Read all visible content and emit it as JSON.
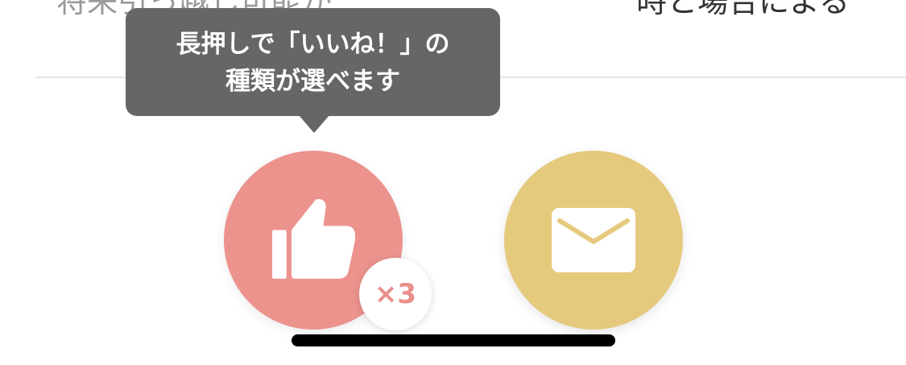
{
  "profile_row": {
    "left_value": "将来引っ越し可能か",
    "right_value": "時と場合による"
  },
  "tooltip": {
    "line1": "長押しで「いいね！」の",
    "line2": "種類が選べます"
  },
  "actions": {
    "like": {
      "icon": "thumbs-up-icon",
      "color": "#ec938e",
      "count_badge": "×3"
    },
    "message": {
      "icon": "envelope-icon",
      "color": "#e5c97d"
    }
  }
}
